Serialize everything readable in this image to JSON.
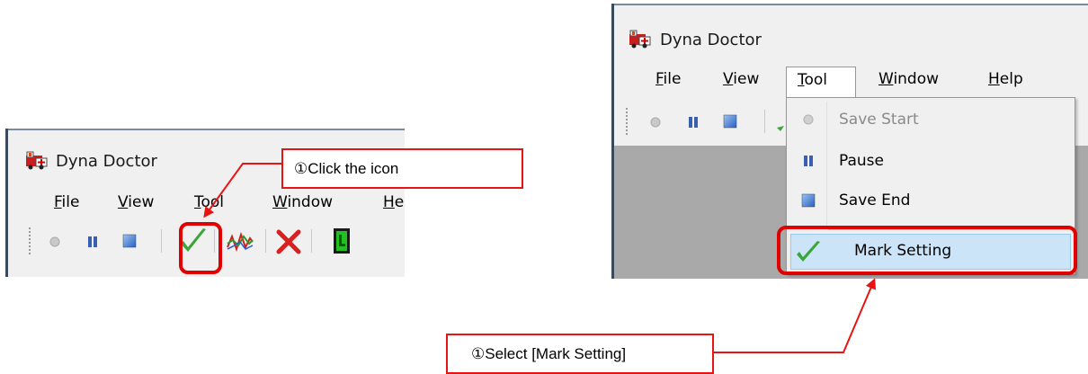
{
  "app": {
    "title": "Dyna Doctor"
  },
  "menu": {
    "file": {
      "first": "F",
      "rest": "ile"
    },
    "view": {
      "first": "V",
      "rest": "iew"
    },
    "tool": {
      "first": "T",
      "rest": "ool"
    },
    "window": {
      "first": "W",
      "rest": "indow"
    },
    "help": {
      "first": "H",
      "rest": "elp"
    }
  },
  "tool_menu": {
    "items": [
      {
        "label": "Save Start",
        "state": "disabled",
        "icon": "record-dot-icon"
      },
      {
        "label": "Pause",
        "state": "enabled",
        "icon": "pause-icon"
      },
      {
        "label": "Save End",
        "state": "enabled",
        "icon": "stop-icon"
      },
      {
        "label": "Mark Setting",
        "state": "hovered",
        "icon": "checkmark-icon"
      }
    ]
  },
  "toolbar": {
    "icons": [
      "record-dot-icon",
      "pause-icon",
      "stop-icon",
      "checkmark-icon",
      "wave-chart-icon",
      "delete-x-icon",
      "green-page-icon"
    ]
  },
  "callouts": {
    "click_icon": "①Click the icon",
    "select_mark": "①Select [Mark Setting]"
  },
  "colors": {
    "highlight_red": "#e00000",
    "menu_hover": "#cce4f7",
    "check_green": "#3aa63a"
  }
}
